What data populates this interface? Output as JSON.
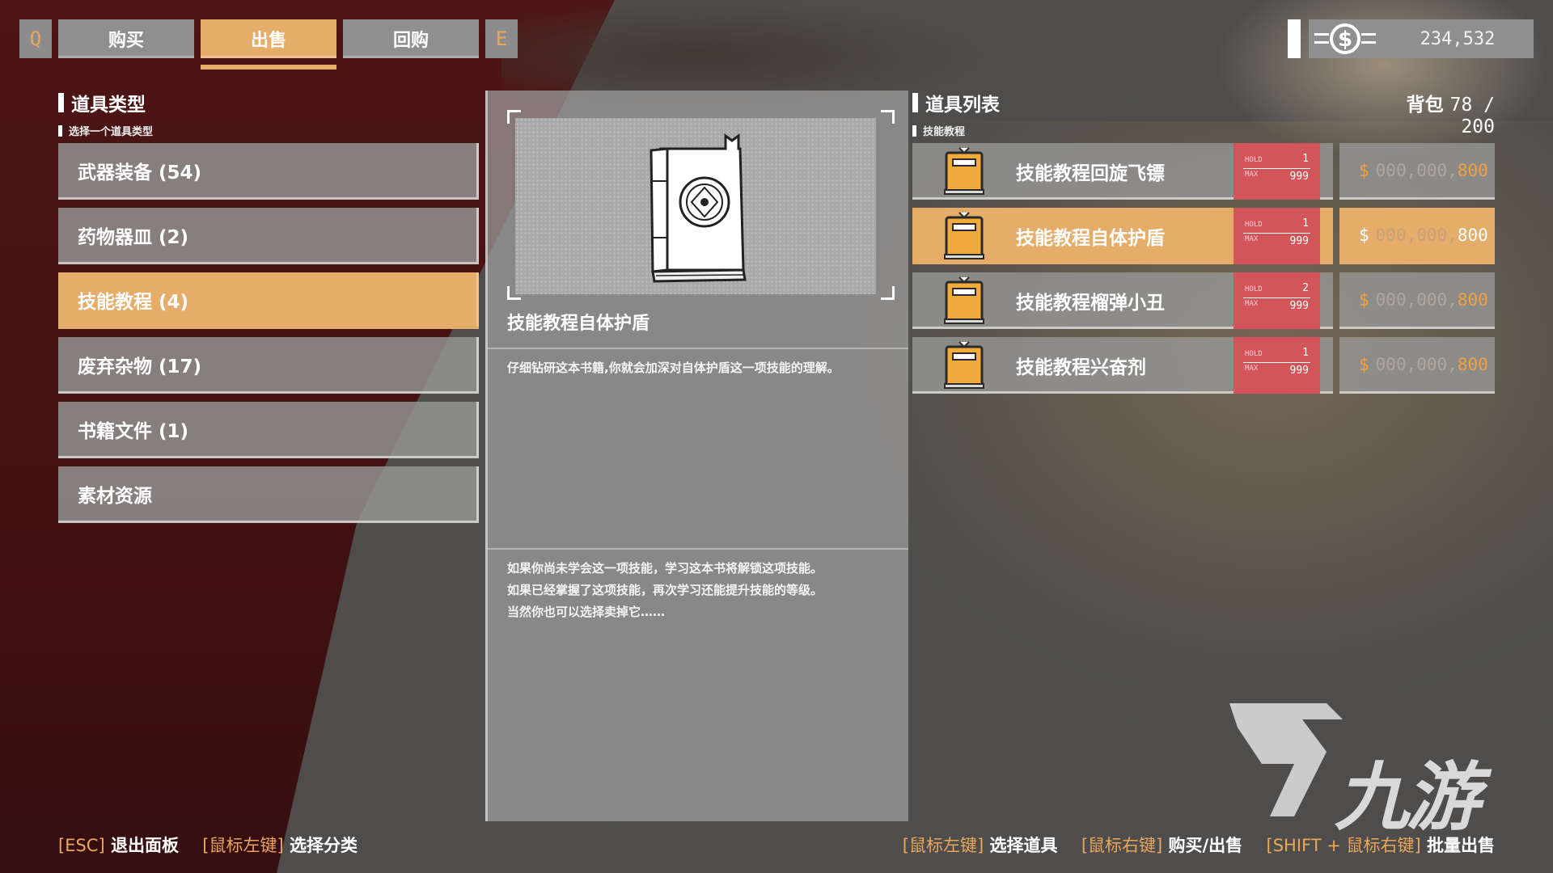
{
  "top_bar": {
    "key_left": "Q",
    "key_right": "E",
    "tabs": [
      {
        "label": "购买"
      },
      {
        "label": "出售"
      },
      {
        "label": "回购"
      }
    ],
    "active_tab": "出售",
    "currency": "234,532",
    "currency_icon": "dollar-coin-icon"
  },
  "categories_panel": {
    "title": "道具类型",
    "subtitle": "选择一个道具类型",
    "items": [
      {
        "label": "武器装备 (54)"
      },
      {
        "label": "药物器皿 (2)"
      },
      {
        "label": "技能教程 (4)"
      },
      {
        "label": "废弃杂物 (17)"
      },
      {
        "label": "书籍文件 (1)"
      },
      {
        "label": "素材资源"
      }
    ],
    "selected": "技能教程 (4)"
  },
  "detail_panel": {
    "item_name": "技能教程自体护盾",
    "desc1": "仔细钻研这本书籍,你就会加深对自体护盾这一项技能的理解。",
    "desc2_lines": [
      "如果你尚未学会这一项技能，学习这本书将解锁这项技能。",
      "如果已经掌握了这项技能，再次学习还能提升技能的等级。",
      "当然你也可以选择卖掉它……"
    ],
    "preview_icon": "book-icon"
  },
  "items_panel": {
    "title": "道具列表",
    "bag_label": "背包",
    "bag_value": "78 / 200",
    "subtitle": "技能教程",
    "hold_label": "HOLD",
    "max_label": "MAX",
    "currency_symbol": "$",
    "rows": [
      {
        "name": "技能教程回旋飞镖",
        "hold": "1",
        "max": "999",
        "price_dim": "000,000,",
        "price": "800"
      },
      {
        "name": "技能教程自体护盾",
        "hold": "1",
        "max": "999",
        "price_dim": "000,000,",
        "price": "800"
      },
      {
        "name": "技能教程榴弹小丑",
        "hold": "2",
        "max": "999",
        "price_dim": "000,000,",
        "price": "800"
      },
      {
        "name": "技能教程兴奋剂",
        "hold": "1",
        "max": "999",
        "price_dim": "000,000,",
        "price": "800"
      }
    ],
    "selected_row": 1
  },
  "hints_left": [
    {
      "key": "[ESC]",
      "action": "退出面板"
    },
    {
      "key": "[鼠标左键]",
      "action": "选择分类"
    }
  ],
  "hints_right": [
    {
      "key": "[鼠标左键]",
      "action": "选择道具"
    },
    {
      "key": "[鼠标右键]",
      "action": "购买/出售"
    },
    {
      "key": "[SHIFT + 鼠标右键]",
      "action": "批量出售"
    }
  ],
  "watermark": "九游",
  "colors": {
    "accent": "#e6ad6a",
    "stock_red": "#d2555a",
    "key_orange": "#e8a75c"
  }
}
